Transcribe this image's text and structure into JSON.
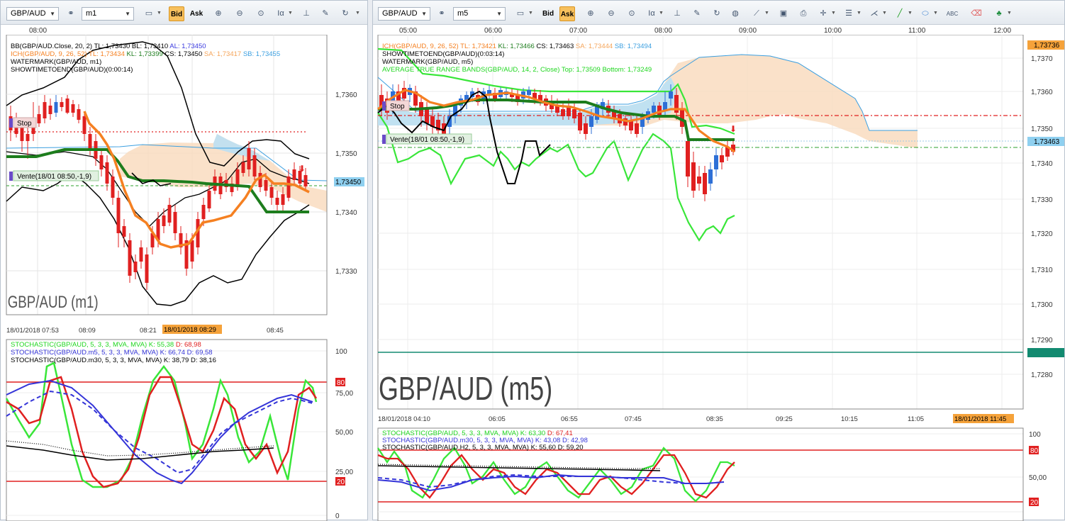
{
  "left": {
    "symbol": "GBP/AUD",
    "timeframe": "m1",
    "bid_label": "Bid",
    "ask_label": "Ask",
    "top_times": [
      "08:00"
    ],
    "legend": [
      {
        "text": "BB(GBP/AUD.Close, 20, 2)",
        "color": "#000000"
      },
      {
        "text": "TL: 1,73430",
        "color": "#000000"
      },
      {
        "text": "BL: 1,73410",
        "color": "#000000"
      },
      {
        "text": "AL: 1,73450",
        "color": "#3a3adf"
      }
    ],
    "legend2": [
      {
        "text": "ICH(GBP/AUD, 9, 26, 52)",
        "color": "#f58021"
      },
      {
        "text": "TL: 1,73434",
        "color": "#f58021"
      },
      {
        "text": "KL: 1,73399",
        "color": "#1d7d1d"
      },
      {
        "text": "CS: 1,73450",
        "color": "#000000"
      },
      {
        "text": "SA: 1,73417",
        "color": "#f5a55a"
      },
      {
        "text": "SB: 1,73455",
        "color": "#3b9fe0"
      }
    ],
    "legend3": "WATERMARK(GBP/AUD, m1)",
    "legend4": "SHOWTIMETOEND(GBP/AUD)(0:00:14)",
    "watermark": "GBP/AUD (m1)",
    "price_ticks": [
      "1,7360",
      "1,7350",
      "1,7340",
      "1,7330"
    ],
    "current_price": "1,73450",
    "stop_label": "Stop",
    "sell_label": "Vente(18/01 08:50,-1,9)",
    "x_ticks": [
      "18/01/2018 07:53",
      "08:09",
      "08:21",
      "08:45"
    ],
    "x_highlight": "18/01/2018 08:29",
    "stoch_legend": [
      {
        "text": "STOCHASTIC(GBP/AUD, 5, 3, 3, MVA, MVA)",
        "k": "K: 55,38",
        "d": "D: 68,98",
        "color": "#1fd61f",
        "dcolor": "#e02020"
      },
      {
        "text": "STOCHASTIC(GBP/AUD.m5, 5, 3, 3, MVA, MVA)",
        "k": "K: 66,74",
        "d": "D: 69,58",
        "color": "#3434d8",
        "dcolor": "#3434d8"
      },
      {
        "text": "STOCHASTIC(GBP/AUD.m30, 5, 3, 3, MVA, MVA)",
        "k": "K: 38,79",
        "d": "D: 38,16",
        "color": "#000000",
        "dcolor": "#000000"
      }
    ],
    "stoch_ticks": [
      "100",
      "80",
      "75,00",
      "50,00",
      "25,00",
      "20",
      "0"
    ]
  },
  "right": {
    "symbol": "GBP/AUD",
    "timeframe": "m5",
    "bid_label": "Bid",
    "ask_label": "Ask",
    "top_times": [
      "05:00",
      "06:00",
      "07:00",
      "08:00",
      "09:00",
      "10:00",
      "11:00",
      "12:00"
    ],
    "legend1": [
      {
        "text": "ICH(GBP/AUD, 9, 26, 52)",
        "color": "#f58021"
      },
      {
        "text": "TL: 1,73421",
        "color": "#f58021"
      },
      {
        "text": "KL: 1,73466",
        "color": "#1d7d1d"
      },
      {
        "text": "CS: 1,73463",
        "color": "#000000"
      },
      {
        "text": "SA: 1,73444",
        "color": "#f5a55a"
      },
      {
        "text": "SB: 1,73494",
        "color": "#3b9fe0"
      }
    ],
    "legend2": "SHOWTIMETOEND(GBP/AUD)(0:03:14)",
    "legend3": "WATERMARK(GBP/AUD, m5)",
    "legend4": "AVERAGE TRUE RANGE BANDS(GBP/AUD, 14, 2, Close)  Top: 1,73509  Bottom: 1,73249",
    "watermark": "GBP/AUD (m5)",
    "price_ticks": [
      "1,7370",
      "1,7360",
      "1,7350",
      "1,7340",
      "1,7330",
      "1,7320",
      "1,7310",
      "1,7300",
      "1,7290",
      "1,7280"
    ],
    "top_price": "1,73736",
    "current_price": "1,73463",
    "stop_label": "Stop",
    "sell_label": "Vente(18/01 08:50,-1,9)",
    "x_ticks": [
      "18/01/2018 04:10",
      "06:05",
      "06:55",
      "07:45",
      "08:35",
      "09:25",
      "10:15",
      "11:05"
    ],
    "x_highlight": "18/01/2018 11:45",
    "stoch_legend": [
      {
        "text": "STOCHASTIC(GBP/AUD, 5, 3, 3, MVA, MVA)",
        "k": "K: 63,30",
        "d": "D: 67,41",
        "color": "#1fd61f",
        "dcolor": "#e02020"
      },
      {
        "text": "STOCHASTIC(GBP/AUD.m30, 5, 3, 3, MVA, MVA)",
        "k": "K: 43,08",
        "d": "D: 42,98",
        "color": "#3434d8",
        "dcolor": "#3434d8"
      },
      {
        "text": "STOCHASTIC(GBP/AUD.H2, 5, 3, 3, MVA, MVA)",
        "k": "K: 55,60",
        "d": "D: 59,20",
        "color": "#000000",
        "dcolor": "#000000"
      }
    ],
    "stoch_ticks": [
      "100",
      "80",
      "50,00",
      "20"
    ]
  },
  "colors": {
    "bull": "#2d6fd6",
    "bear": "#e02020",
    "kijun": "#1d7d1d",
    "tenkan": "#f58021",
    "active_button": "#f7c05d",
    "price_tag": "#8fd0f0",
    "highlight_tag": "#f5a23a"
  }
}
